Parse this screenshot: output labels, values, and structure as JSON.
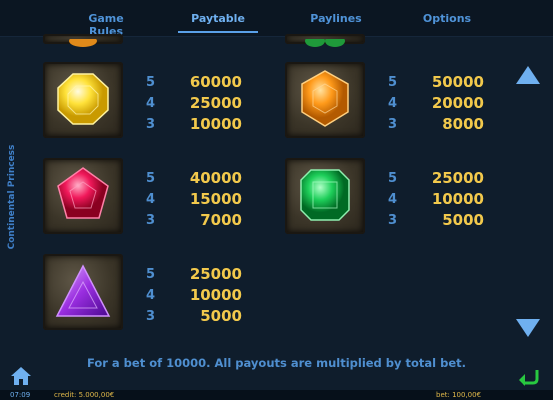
{
  "tabs": [
    {
      "label": "Game Rules"
    },
    {
      "label": "Paytable"
    },
    {
      "label": "Paylines"
    },
    {
      "label": "Options"
    }
  ],
  "side_title": "Continental Princess",
  "paytable": [
    {
      "gem": "yellow-octagon-gem-icon",
      "rows": [
        {
          "n": "5",
          "v": "60000"
        },
        {
          "n": "4",
          "v": "25000"
        },
        {
          "n": "3",
          "v": "10000"
        }
      ]
    },
    {
      "gem": "orange-hexagon-gem-icon",
      "rows": [
        {
          "n": "5",
          "v": "50000"
        },
        {
          "n": "4",
          "v": "20000"
        },
        {
          "n": "3",
          "v": "8000"
        }
      ]
    },
    {
      "gem": "red-pentagon-gem-icon",
      "rows": [
        {
          "n": "5",
          "v": "40000"
        },
        {
          "n": "4",
          "v": "15000"
        },
        {
          "n": "3",
          "v": "7000"
        }
      ]
    },
    {
      "gem": "green-emerald-gem-icon",
      "rows": [
        {
          "n": "5",
          "v": "25000"
        },
        {
          "n": "4",
          "v": "10000"
        },
        {
          "n": "3",
          "v": "5000"
        }
      ]
    },
    {
      "gem": "purple-triangle-gem-icon",
      "rows": [
        {
          "n": "5",
          "v": "25000"
        },
        {
          "n": "4",
          "v": "10000"
        },
        {
          "n": "3",
          "v": "5000"
        }
      ]
    }
  ],
  "footer_note": "For a bet of 10000. All payouts are multiplied by total bet.",
  "status": {
    "time": "07:09",
    "credit": "credit: 5.000,00€",
    "bet": "bet: 100,00€"
  },
  "colors": {
    "accent": "#4f8fd0",
    "payout": "#f2c94c",
    "background": "#0f1d2c"
  }
}
